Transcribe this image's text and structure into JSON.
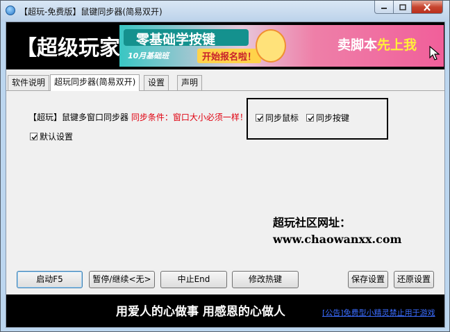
{
  "window": {
    "title": "【超玩-免费版】鼠键同步器(简易双开)"
  },
  "banner": {
    "brand": "【超级玩家",
    "ad_headline": "零基础学按键",
    "ad_month": "10月基础班",
    "ad_cta": "开始报名啦！",
    "ad_right_white": "卖脚本",
    "ad_right_yellow": "先上我"
  },
  "tabs": [
    {
      "label": "软件说明"
    },
    {
      "label": "超玩同步器(简易双开)"
    },
    {
      "label": "设置"
    },
    {
      "label": "声明"
    }
  ],
  "page": {
    "desc_black": "【超玩】鼠键多窗口同步器",
    "desc_red": "同步条件：窗口大小必须一样！",
    "sync_mouse": {
      "label": "同步鼠标",
      "checked": true
    },
    "sync_keys": {
      "label": "同步按键",
      "checked": true
    },
    "default_settings": {
      "label": "默认设置",
      "checked": true
    },
    "site_label": "超玩社区网址：",
    "site_url": "www.chaowanxx.com"
  },
  "buttons": {
    "start": "启动F5",
    "pause": "暂停/继续<无>",
    "stop": "中止End",
    "hotkey": "修改热键",
    "save": "保存设置",
    "restore": "还原设置"
  },
  "footer": {
    "slogan": "用爱人的心做事 用感恩的心做人",
    "link": "[公告]免费型小精灵禁止用于游戏"
  },
  "colors": {
    "accent_red": "#e0000f",
    "link_blue": "#3a6cff",
    "banner_bg": "#000000"
  },
  "icons": {
    "app": "app-icon",
    "checkmark": "checkmark-icon",
    "cursor": "mouse-cursor-icon"
  }
}
